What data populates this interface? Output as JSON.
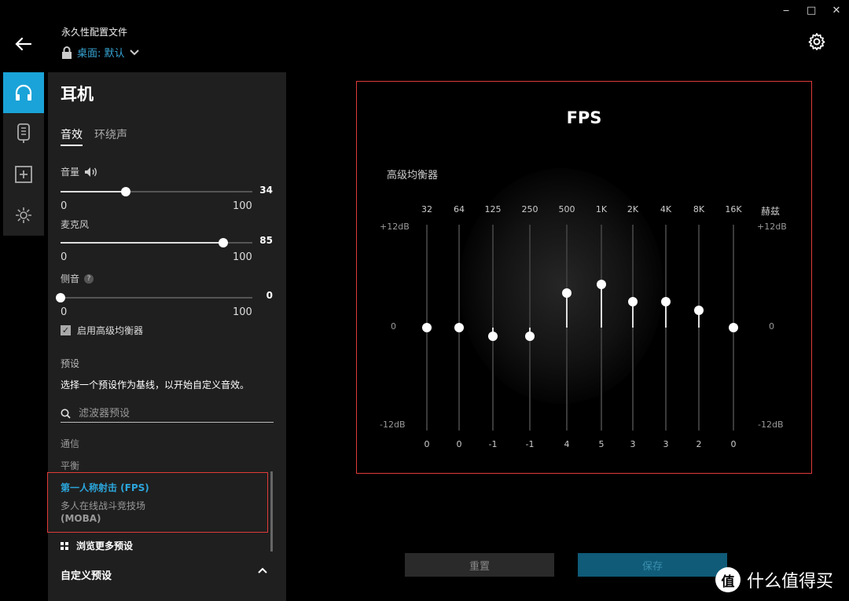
{
  "window": {
    "minimize": "‒",
    "maximize": "□",
    "close": "✕"
  },
  "header": {
    "profile_title": "永久性配置文件",
    "profile_value": "桌面: 默认"
  },
  "rail": {
    "items": [
      "headset-icon",
      "device-icon",
      "add-icon",
      "lighting-icon"
    ],
    "accent": "#1aa3d8"
  },
  "panel": {
    "title": "耳机",
    "tabs": [
      {
        "label": "音效"
      },
      {
        "label": "环绕声"
      }
    ],
    "volume": {
      "label": "音量",
      "value": "34",
      "min": "0",
      "max": "100",
      "level": 0.34
    },
    "mic": {
      "label": "麦克风",
      "value": "85",
      "min": "0",
      "max": "100",
      "level": 0.85
    },
    "sidetone": {
      "label": "侧音",
      "value": "0",
      "min": "0",
      "max": "100",
      "level": 0,
      "help": "?"
    },
    "advanced_eq": {
      "label": "启用高级均衡器",
      "checked": true
    },
    "presets": {
      "heading": "预设",
      "description": "选择一个预设作为基线，以开始自定义音效。",
      "search_placeholder": "滤波器预设",
      "items": [
        "通信",
        "平衡",
        "第一人称射击 (FPS)",
        "多人在线战斗竞技场",
        "(MOBA)"
      ],
      "browse_label": "浏览更多预设",
      "custom_label": "自定义预设"
    }
  },
  "eq": {
    "title": "FPS",
    "label": "高级均衡器",
    "unit_label": "赫兹",
    "db_top": "+12dB",
    "db_mid": "0",
    "db_bottom": "-12dB",
    "range_db": [
      -12,
      12
    ],
    "bands": [
      {
        "freq": "32",
        "gain": 0,
        "value": "0"
      },
      {
        "freq": "64",
        "gain": 0,
        "value": "0"
      },
      {
        "freq": "125",
        "gain": -1,
        "value": "-1"
      },
      {
        "freq": "250",
        "gain": -1,
        "value": "-1"
      },
      {
        "freq": "500",
        "gain": 4,
        "value": "4"
      },
      {
        "freq": "1K",
        "gain": 5,
        "value": "5"
      },
      {
        "freq": "2K",
        "gain": 3,
        "value": "3"
      },
      {
        "freq": "4K",
        "gain": 3,
        "value": "3"
      },
      {
        "freq": "8K",
        "gain": 2,
        "value": "2"
      },
      {
        "freq": "16K",
        "gain": 0,
        "value": "0"
      }
    ]
  },
  "actions": {
    "reset": "重置",
    "save": "保存"
  },
  "watermark": {
    "badge": "值",
    "text": "什么值得买"
  }
}
